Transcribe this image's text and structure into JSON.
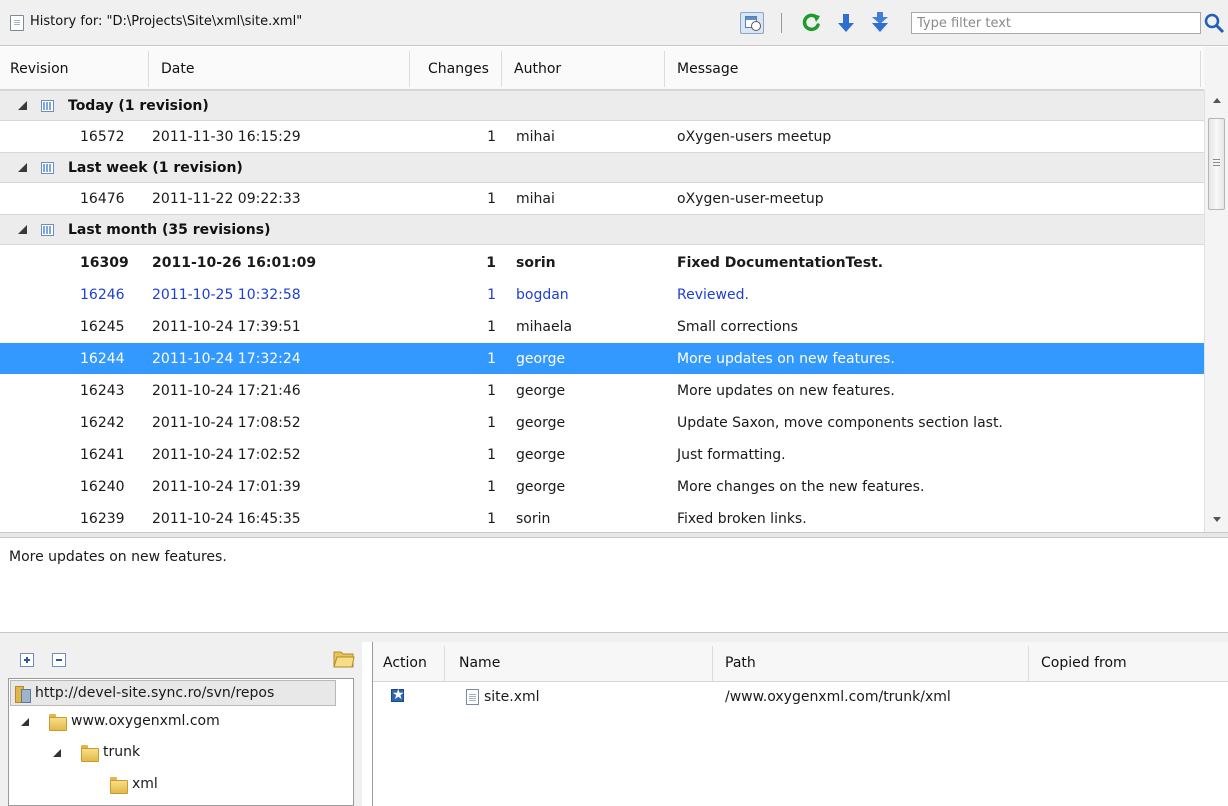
{
  "toolbar": {
    "title": "History for: \"D:\\Projects\\Site\\xml\\site.xml\"",
    "filter_placeholder": "Type filter text",
    "icons": [
      "document-icon",
      "history-calendar-icon",
      "refresh-icon",
      "arrow-down-icon",
      "double-arrow-down-icon",
      "search-icon"
    ]
  },
  "table": {
    "columns": [
      "Revision",
      "Date",
      "Changes",
      "Author",
      "Message"
    ],
    "groups": [
      {
        "label": "Today (1 revision)",
        "rows": [
          {
            "revision": "16572",
            "date": "2011-11-30 16:15:29",
            "changes": "1",
            "author": "mihai",
            "message": "oXygen-users meetup"
          }
        ]
      },
      {
        "label": "Last week (1 revision)",
        "rows": [
          {
            "revision": "16476",
            "date": "2011-11-22 09:22:33",
            "changes": "1",
            "author": "mihai",
            "message": "oXygen-user-meetup"
          }
        ]
      },
      {
        "label": "Last month (35 revisions)",
        "rows": [
          {
            "revision": "16309",
            "date": "2011-10-26 16:01:09",
            "changes": "1",
            "author": "sorin",
            "message": "Fixed DocumentationTest.",
            "style": "bold"
          },
          {
            "revision": "16246",
            "date": "2011-10-25 10:32:58",
            "changes": "1",
            "author": "bogdan",
            "message": "Reviewed.",
            "style": "blue"
          },
          {
            "revision": "16245",
            "date": "2011-10-24 17:39:51",
            "changes": "1",
            "author": "mihaela",
            "message": "Small corrections"
          },
          {
            "revision": "16244",
            "date": "2011-10-24 17:32:24",
            "changes": "1",
            "author": "george",
            "message": "More updates on new features.",
            "style": "selected"
          },
          {
            "revision": "16243",
            "date": "2011-10-24 17:21:46",
            "changes": "1",
            "author": "george",
            "message": "More updates on new features."
          },
          {
            "revision": "16242",
            "date": "2011-10-24 17:08:52",
            "changes": "1",
            "author": "george",
            "message": "Update Saxon, move components section last."
          },
          {
            "revision": "16241",
            "date": "2011-10-24 17:02:52",
            "changes": "1",
            "author": "george",
            "message": "Just formatting."
          },
          {
            "revision": "16240",
            "date": "2011-10-24 17:01:39",
            "changes": "1",
            "author": "george",
            "message": "More changes on the new features."
          },
          {
            "revision": "16239",
            "date": "2011-10-24 16:45:35",
            "changes": "1",
            "author": "sorin",
            "message": "Fixed broken links."
          }
        ]
      }
    ]
  },
  "message_pane": {
    "text": "More updates on new features."
  },
  "tree": {
    "repository": "http://devel-site.sync.ro/svn/repos",
    "nodes": [
      {
        "label": "www.oxygenxml.com"
      },
      {
        "label": "trunk"
      },
      {
        "label": "xml"
      }
    ]
  },
  "changed_paths": {
    "columns": [
      "Action",
      "Name",
      "Path",
      "Copied from"
    ],
    "rows": [
      {
        "action": "modified",
        "name": "site.xml",
        "path": "/www.oxygenxml.com/trunk/xml",
        "copied_from": ""
      }
    ]
  },
  "colors": {
    "selection": "#3399ff",
    "link_blue": "#1f3fd0",
    "group_bg": "#ececec"
  }
}
